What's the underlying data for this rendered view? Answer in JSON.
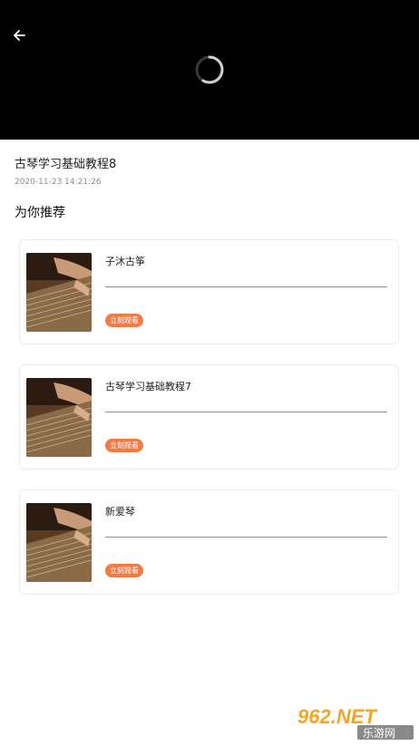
{
  "video": {
    "title": "古琴学习基础教程8",
    "time": "2020-11-23 14:21:26"
  },
  "recommend": {
    "heading": "为你推荐",
    "items": [
      {
        "name": "子沐古筝",
        "button": "立刻观看"
      },
      {
        "name": "古琴学习基础教程7",
        "button": "立刻观看"
      },
      {
        "name": "新爱琴",
        "button": "立刻观看"
      }
    ]
  },
  "watermark": {
    "text": "962.NET",
    "sub": "乐游网"
  },
  "icons": {
    "back": "arrow-left-icon",
    "loading": "loading-spinner-icon"
  },
  "colors": {
    "player_bg": "#000000",
    "accent": "#f07b45"
  }
}
